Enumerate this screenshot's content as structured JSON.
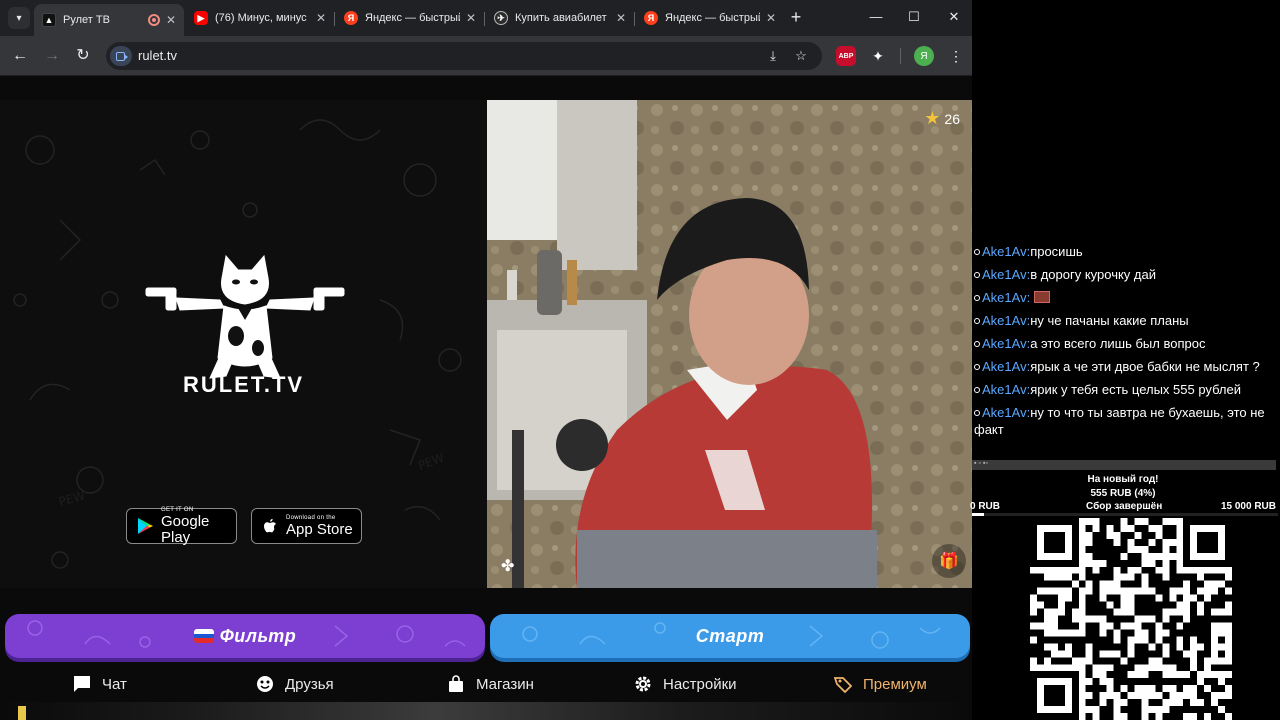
{
  "browser": {
    "tabs": [
      {
        "title": "Рулет ТВ",
        "active": true,
        "recording": true
      },
      {
        "title": "(76) Минус, минус"
      },
      {
        "title": "Яндекс — быстрый"
      },
      {
        "title": "Купить авиабилет"
      },
      {
        "title": "Яндекс — быстрый"
      }
    ],
    "url": "rulet.tv",
    "profile_initial": "Я",
    "abp_label": "ABP"
  },
  "site": {
    "logo_text": "RULET.TV",
    "google_play": {
      "small": "GET IT ON",
      "big": "Google Play"
    },
    "app_store": {
      "small": "Download on the",
      "big": "App Store"
    },
    "star_count": "26",
    "filter_label": "Фильтр",
    "start_label": "Старт",
    "nav": [
      {
        "label": "Чат",
        "icon": "chat-icon"
      },
      {
        "label": "Друзья",
        "icon": "friends-icon"
      },
      {
        "label": "Магазин",
        "icon": "shop-icon"
      },
      {
        "label": "Настройки",
        "icon": "settings-icon"
      },
      {
        "label": "Премиум",
        "icon": "premium-icon"
      }
    ]
  },
  "overlay": {
    "chat": [
      {
        "user": "Ake1Av:",
        "text": "просишь"
      },
      {
        "user": "Ake1Av:",
        "text": "в дорогу курочку дай"
      },
      {
        "user": "Ake1Av:",
        "text": "",
        "emote": true
      },
      {
        "user": "Ake1Av:",
        "text": "ну че пачаны какие планы"
      },
      {
        "user": "Ake1Av:",
        "text": "а это всего лишь был вопрос"
      },
      {
        "user": "Ake1Av:",
        "text": "ярык а че эти двое бабки не мыслят ?"
      },
      {
        "user": "Ake1Av:",
        "text": "ярик у тебя есть целых 555 рублей"
      },
      {
        "user": "Ake1Av:",
        "text": "ну то что ты завтра не бухаешь, это не факт"
      }
    ],
    "donation": {
      "title": "На новый год!",
      "amount": "555 RUB (4%)",
      "min": "0 RUB",
      "status": "Сбор завершён",
      "max": "15 000 RUB",
      "progress": 0.04
    }
  }
}
